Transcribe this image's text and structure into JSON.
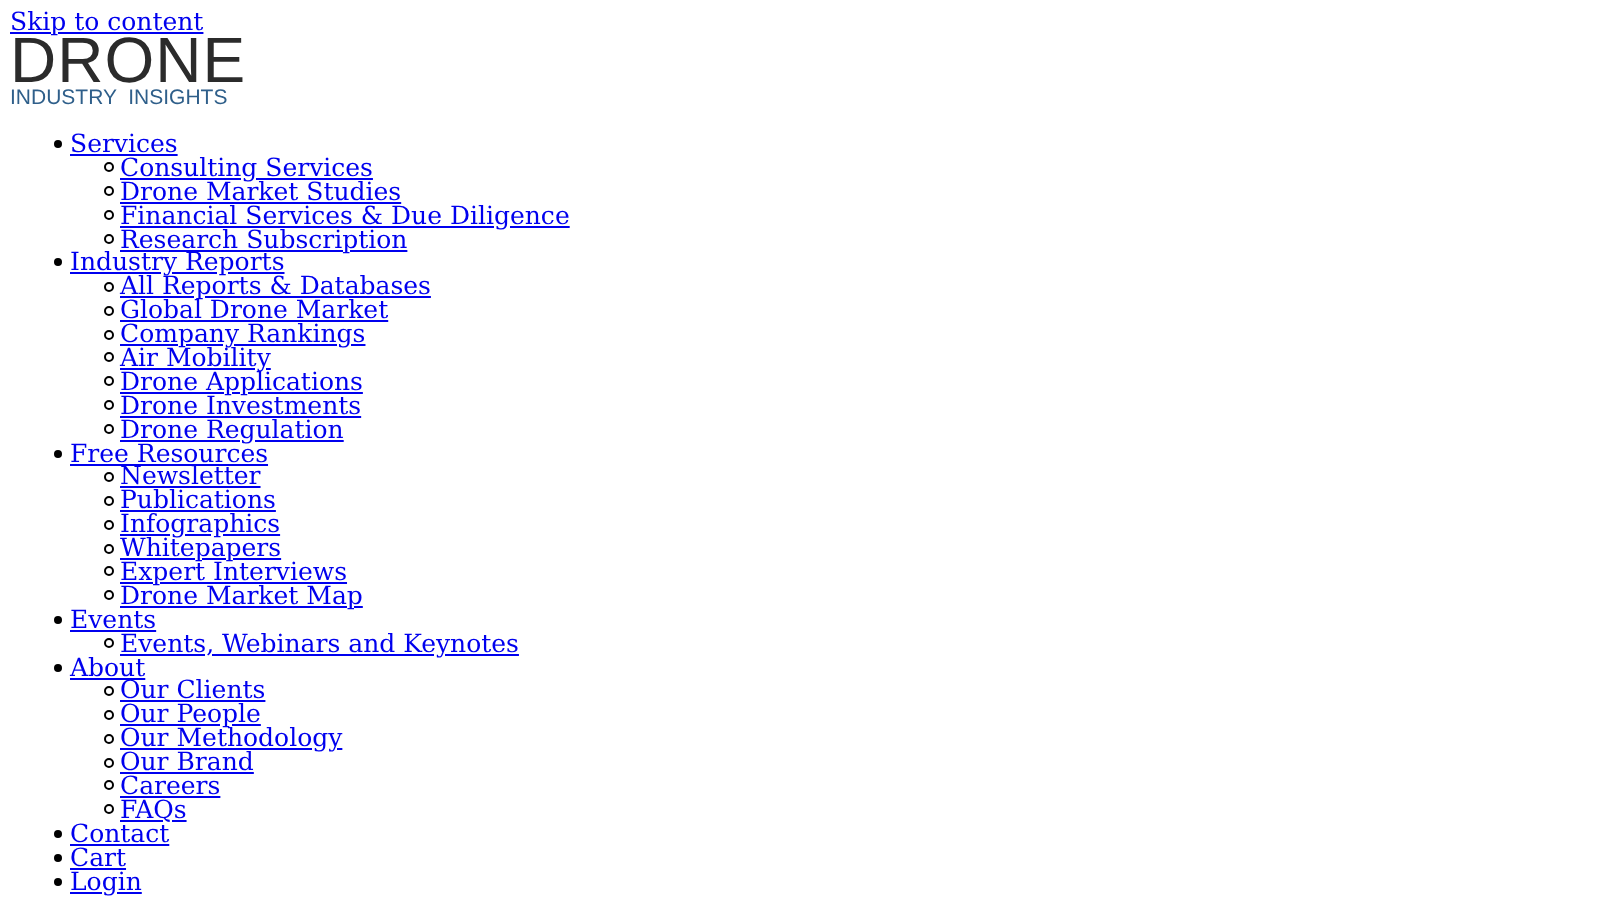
{
  "skip_link": "Skip to content",
  "logo": {
    "title": "DRONE",
    "subtitle": "INDUSTRY  INSIGHTS"
  },
  "nav": [
    {
      "label": "Services",
      "children": [
        {
          "label": "Consulting Services"
        },
        {
          "label": "Drone Market Studies"
        },
        {
          "label": "Financial Services & Due Diligence"
        },
        {
          "label": "Research Subscription"
        }
      ]
    },
    {
      "label": "Industry Reports",
      "children": [
        {
          "label": "All Reports & Databases"
        },
        {
          "label": "Global Drone Market"
        },
        {
          "label": "Company Rankings"
        },
        {
          "label": "Air Mobility"
        },
        {
          "label": "Drone Applications"
        },
        {
          "label": "Drone Investments"
        },
        {
          "label": "Drone Regulation"
        }
      ]
    },
    {
      "label": "Free Resources",
      "children": [
        {
          "label": "Newsletter"
        },
        {
          "label": "Publications"
        },
        {
          "label": "Infographics"
        },
        {
          "label": "Whitepapers"
        },
        {
          "label": "Expert Interviews"
        },
        {
          "label": "Drone Market Map"
        }
      ]
    },
    {
      "label": "Events",
      "children": [
        {
          "label": "Events, Webinars and Keynotes"
        }
      ]
    },
    {
      "label": "About",
      "children": [
        {
          "label": "Our Clients"
        },
        {
          "label": "Our People"
        },
        {
          "label": "Our Methodology"
        },
        {
          "label": "Our Brand"
        },
        {
          "label": "Careers"
        },
        {
          "label": "FAQs"
        }
      ]
    },
    {
      "label": "Contact"
    },
    {
      "label": "Cart"
    },
    {
      "label": "Login"
    }
  ]
}
